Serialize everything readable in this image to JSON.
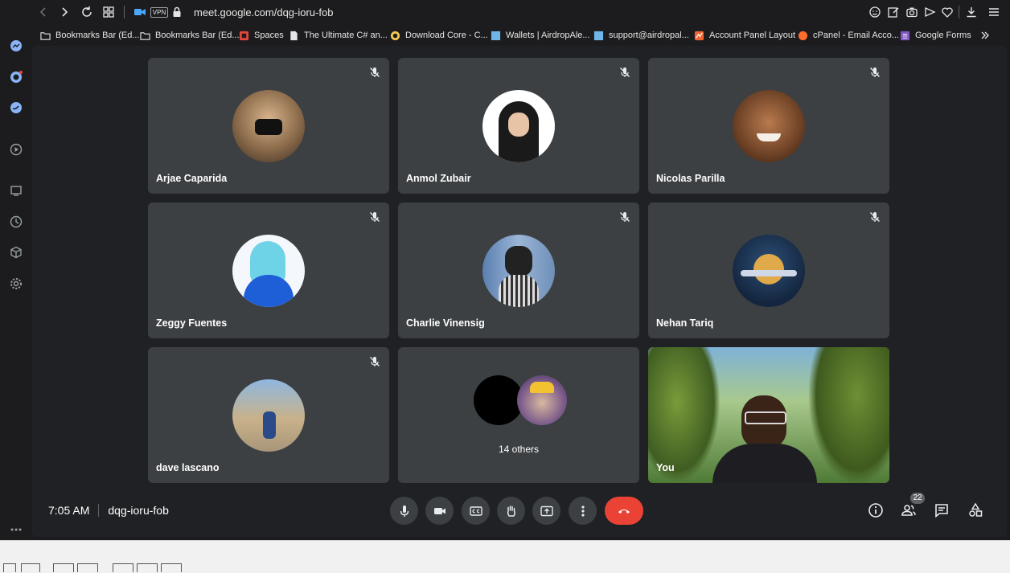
{
  "browser": {
    "url": "meet.google.com/dqg-ioru-fob",
    "vpn_label": "VPN",
    "bookmarks": [
      {
        "label": "Bookmarks Bar (Ed...",
        "icon": "folder-icon"
      },
      {
        "label": "Bookmarks Bar (Ed...",
        "icon": "folder-icon"
      },
      {
        "label": "Spaces",
        "icon": "spaces-icon"
      },
      {
        "label": "The Ultimate C# an...",
        "icon": "document-icon"
      },
      {
        "label": "Download Core - C...",
        "icon": "core-icon"
      },
      {
        "label": "Wallets | AirdropAle...",
        "icon": "wallets-icon"
      },
      {
        "label": "support@airdropal...",
        "icon": "support-icon"
      },
      {
        "label": "Account Panel Layout",
        "icon": "account-panel-icon"
      },
      {
        "label": "cPanel - Email Acco...",
        "icon": "cpanel-icon"
      },
      {
        "label": "Google Forms",
        "icon": "forms-icon"
      }
    ]
  },
  "meeting": {
    "time": "7:05 AM",
    "code": "dqg-ioru-fob",
    "participant_count": "22",
    "participants": [
      {
        "name": "Arjae Caparida",
        "muted": true
      },
      {
        "name": "Anmol Zubair",
        "muted": true
      },
      {
        "name": "Nicolas Parilla",
        "muted": true
      },
      {
        "name": "Zeggy Fuentes",
        "muted": true
      },
      {
        "name": "Charlie Vinensig",
        "muted": true
      },
      {
        "name": "Nehan Tariq",
        "muted": true
      },
      {
        "name": "dave lascano",
        "muted": true
      }
    ],
    "others_label": "14 others",
    "self_label": "You"
  },
  "colors": {
    "end_call": "#ea4335",
    "tile_bg": "#3c4043",
    "meet_bg": "#202124"
  }
}
